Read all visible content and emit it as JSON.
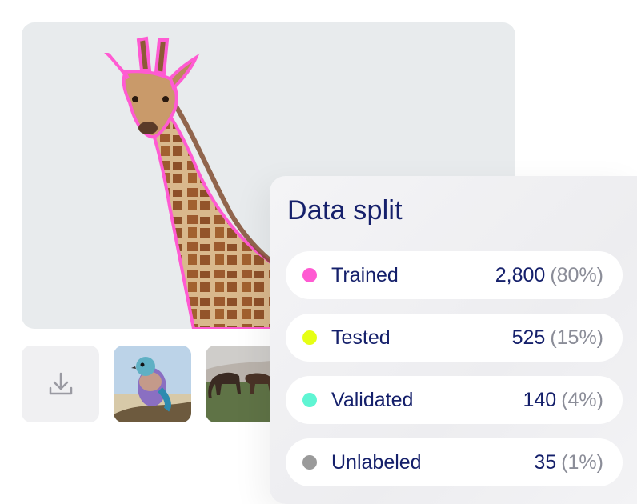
{
  "main_image": {
    "subject": "giraffe",
    "outline_color": "#ff5ad2"
  },
  "download_button": {
    "icon": "download-icon"
  },
  "thumbnails": [
    {
      "subject": "lilac-breasted roller bird"
    },
    {
      "subject": "horses grazing"
    }
  ],
  "data_split": {
    "title": "Data split",
    "rows": [
      {
        "label": "Trained",
        "count": "2,800",
        "percent": "(80%)",
        "color": "#ff5ad2"
      },
      {
        "label": "Tested",
        "count": "525",
        "percent": "(15%)",
        "color": "#e6ff14"
      },
      {
        "label": "Validated",
        "count": "140",
        "percent": "(4%)",
        "color": "#5ff5d3"
      },
      {
        "label": "Unlabeled",
        "count": "35",
        "percent": "(1%)",
        "color": "#9a9a9a"
      }
    ]
  }
}
